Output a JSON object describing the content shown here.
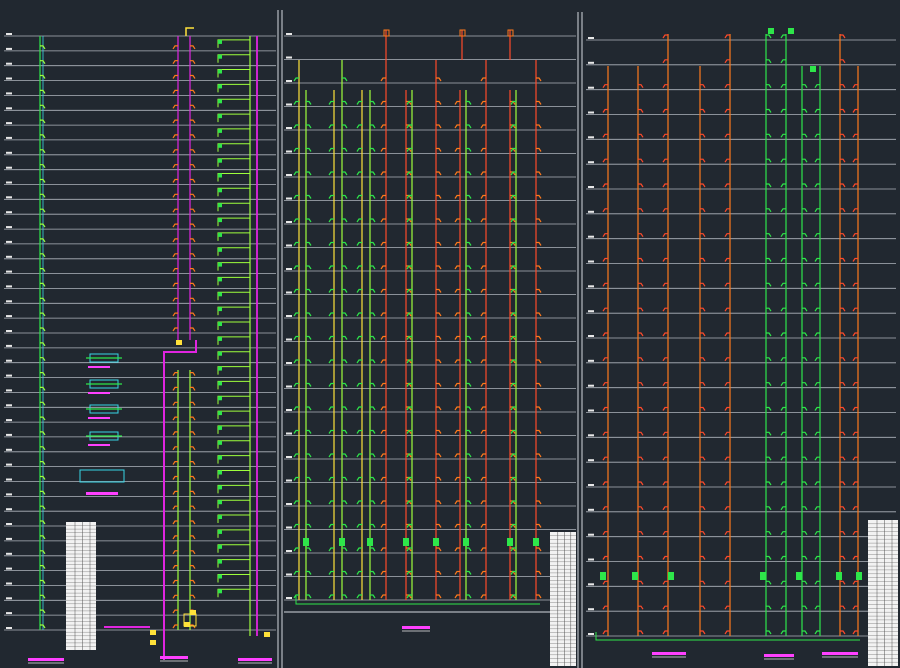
{
  "app": {
    "title": ""
  },
  "colors": {
    "background": "#212830",
    "floor_line": "#c9ced6",
    "sheet_border": "#d4d8de",
    "pipe_green": "#2ee64a",
    "pipe_lime": "#9eff3c",
    "pipe_magenta": "#e025e0",
    "pipe_red": "#ff4a2a",
    "pipe_orange": "#ff7a1c",
    "pipe_yellow": "#ffe23a",
    "pipe_cyan": "#38d6e6",
    "label_white": "#e8e8e8",
    "table_fill": "#f2f2f2",
    "title_magenta": "#ff40ff"
  },
  "sheets": [
    {
      "id": "sheet-1",
      "floors": 40
    },
    {
      "id": "sheet-2",
      "floors": 24
    },
    {
      "id": "sheet-3",
      "floors": 24
    }
  ],
  "legend_icons": [
    "fire-hydrant-detail-icon",
    "fire-hydrant-detail-icon",
    "fire-hydrant-detail-icon",
    "fire-hydrant-detail-icon",
    "valve-assembly-icon"
  ]
}
